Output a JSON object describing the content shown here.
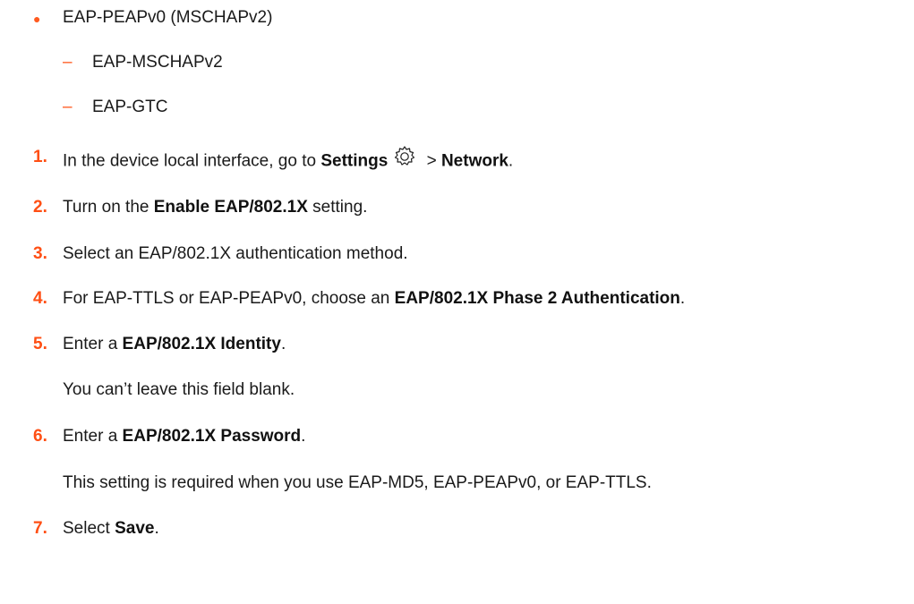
{
  "colors": {
    "accent": "#ff4f14",
    "text": "#1a1a1a"
  },
  "bullets": [
    {
      "text": "EAP-PEAPv0 (MSCHAPv2)"
    }
  ],
  "sub_bullets": [
    {
      "text": "EAP-MSCHAPv2"
    },
    {
      "text": "EAP-GTC"
    }
  ],
  "steps": [
    {
      "num": "1.",
      "pre": "In the device local interface, go to ",
      "b1": "Settings",
      "icon": "gear-icon",
      "mid": " > ",
      "b2": "Network",
      "post": "."
    },
    {
      "num": "2.",
      "pre": "Turn on the ",
      "b1": "Enable EAP/802.1X",
      "post": " setting."
    },
    {
      "num": "3.",
      "pre": "Select an EAP/802.1X authentication method."
    },
    {
      "num": "4.",
      "pre": "For EAP-TTLS or EAP-PEAPv0, choose an ",
      "b1": "EAP/802.1X Phase 2 Authentication",
      "post": "."
    },
    {
      "num": "5.",
      "pre": "Enter a ",
      "b1": "EAP/802.1X Identity",
      "post": ".",
      "note": "You can’t leave this field blank."
    },
    {
      "num": "6.",
      "pre": "Enter a ",
      "b1": "EAP/802.1X Password",
      "post": ".",
      "note": "This setting is required when you use EAP-MD5, EAP-PEAPv0, or EAP-TTLS."
    },
    {
      "num": "7.",
      "pre": "Select ",
      "b1": "Save",
      "post": "."
    }
  ]
}
